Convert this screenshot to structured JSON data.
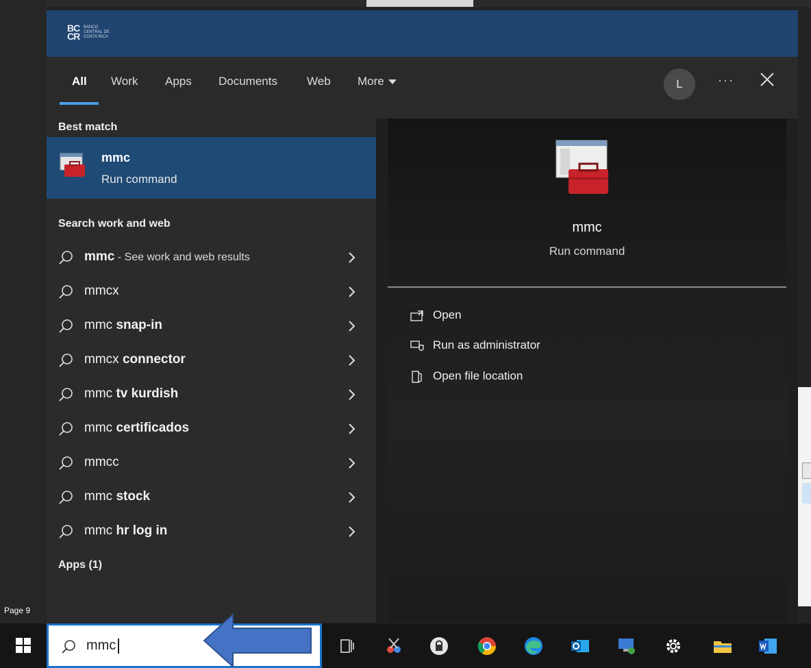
{
  "brand": {
    "logo_initials": "BC CR",
    "logo_text": "BANCO CENTRAL DE COSTA RICA"
  },
  "tabs": [
    {
      "label": "All",
      "active": true
    },
    {
      "label": "Work"
    },
    {
      "label": "Apps"
    },
    {
      "label": "Documents"
    },
    {
      "label": "Web"
    },
    {
      "label": "More"
    }
  ],
  "account_initial": "L",
  "more_options": "···",
  "best_match": {
    "heading": "Best match",
    "title": "mmc",
    "subtitle": "Run command"
  },
  "search_section": {
    "heading": "Search work and web",
    "items": [
      {
        "prefix": "mmc",
        "bold": "",
        "suffix": " - See work and web results"
      },
      {
        "prefix": "mmcx",
        "bold": "",
        "suffix": ""
      },
      {
        "prefix": "mmc ",
        "bold": "snap-in",
        "suffix": ""
      },
      {
        "prefix": "mmcx ",
        "bold": "connector",
        "suffix": ""
      },
      {
        "prefix": "mmc ",
        "bold": "tv kurdish",
        "suffix": ""
      },
      {
        "prefix": "mmc ",
        "bold": "certificados",
        "suffix": ""
      },
      {
        "prefix": "mmcc",
        "bold": "",
        "suffix": ""
      },
      {
        "prefix": "mmc ",
        "bold": "stock",
        "suffix": ""
      },
      {
        "prefix": "mmc ",
        "bold": "hr log in",
        "suffix": ""
      }
    ]
  },
  "apps_heading": "Apps (1)",
  "preview": {
    "title": "mmc",
    "subtitle": "Run command",
    "actions": [
      {
        "label": "Open",
        "icon": "open-icon"
      },
      {
        "label": "Run as administrator",
        "icon": "shield-run-icon"
      },
      {
        "label": "Open file location",
        "icon": "folder-location-icon"
      }
    ]
  },
  "page_label": "Page 9 ",
  "taskbar": {
    "search_value": "mmc",
    "icons": [
      "task-view-icon",
      "snipping-tool-icon",
      "lock-app-icon",
      "chrome-icon",
      "edge-icon",
      "outlook-icon",
      "remote-desktop-icon",
      "settings-icon",
      "file-explorer-icon",
      "word-icon"
    ]
  },
  "colors": {
    "brand_bar": "#1f4470",
    "selected_row": "#1e4a75",
    "accent": "#4aa0e6",
    "annotation_arrow": "#4472c4"
  }
}
